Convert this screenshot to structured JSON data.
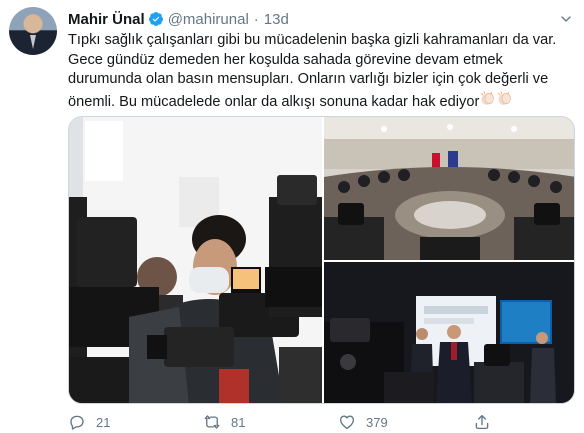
{
  "tweet": {
    "author": {
      "name": "Mahir Ünal",
      "handle": "@mahirunal",
      "verified": true
    },
    "separator": "·",
    "time": "13d",
    "text_lines": [
      "Tıpkı sağlık çalışanları gibi bu mücadelenin başka gizli kahramanları da var.",
      "Gece gündüz demeden her koşulda sahada görevine devam etmek",
      "durumunda olan basın mensupları. Onların varlığı bizler için çok değerli ve",
      "önemli. Bu mücadelede onlar da alkışı sonuna kadar hak ediyor"
    ],
    "emoji": [
      "clapping-hands",
      "clapping-hands"
    ],
    "stats": {
      "replies": "21",
      "retweets": "81",
      "likes": "379"
    }
  },
  "colors": {
    "text": "#14171a",
    "secondary": "#657786",
    "verified": "#1da1f2",
    "border": "#ccd6dd"
  },
  "icons": [
    "verified-badge-icon",
    "chevron-down-icon",
    "reply-icon",
    "retweet-icon",
    "like-icon",
    "share-icon"
  ]
}
